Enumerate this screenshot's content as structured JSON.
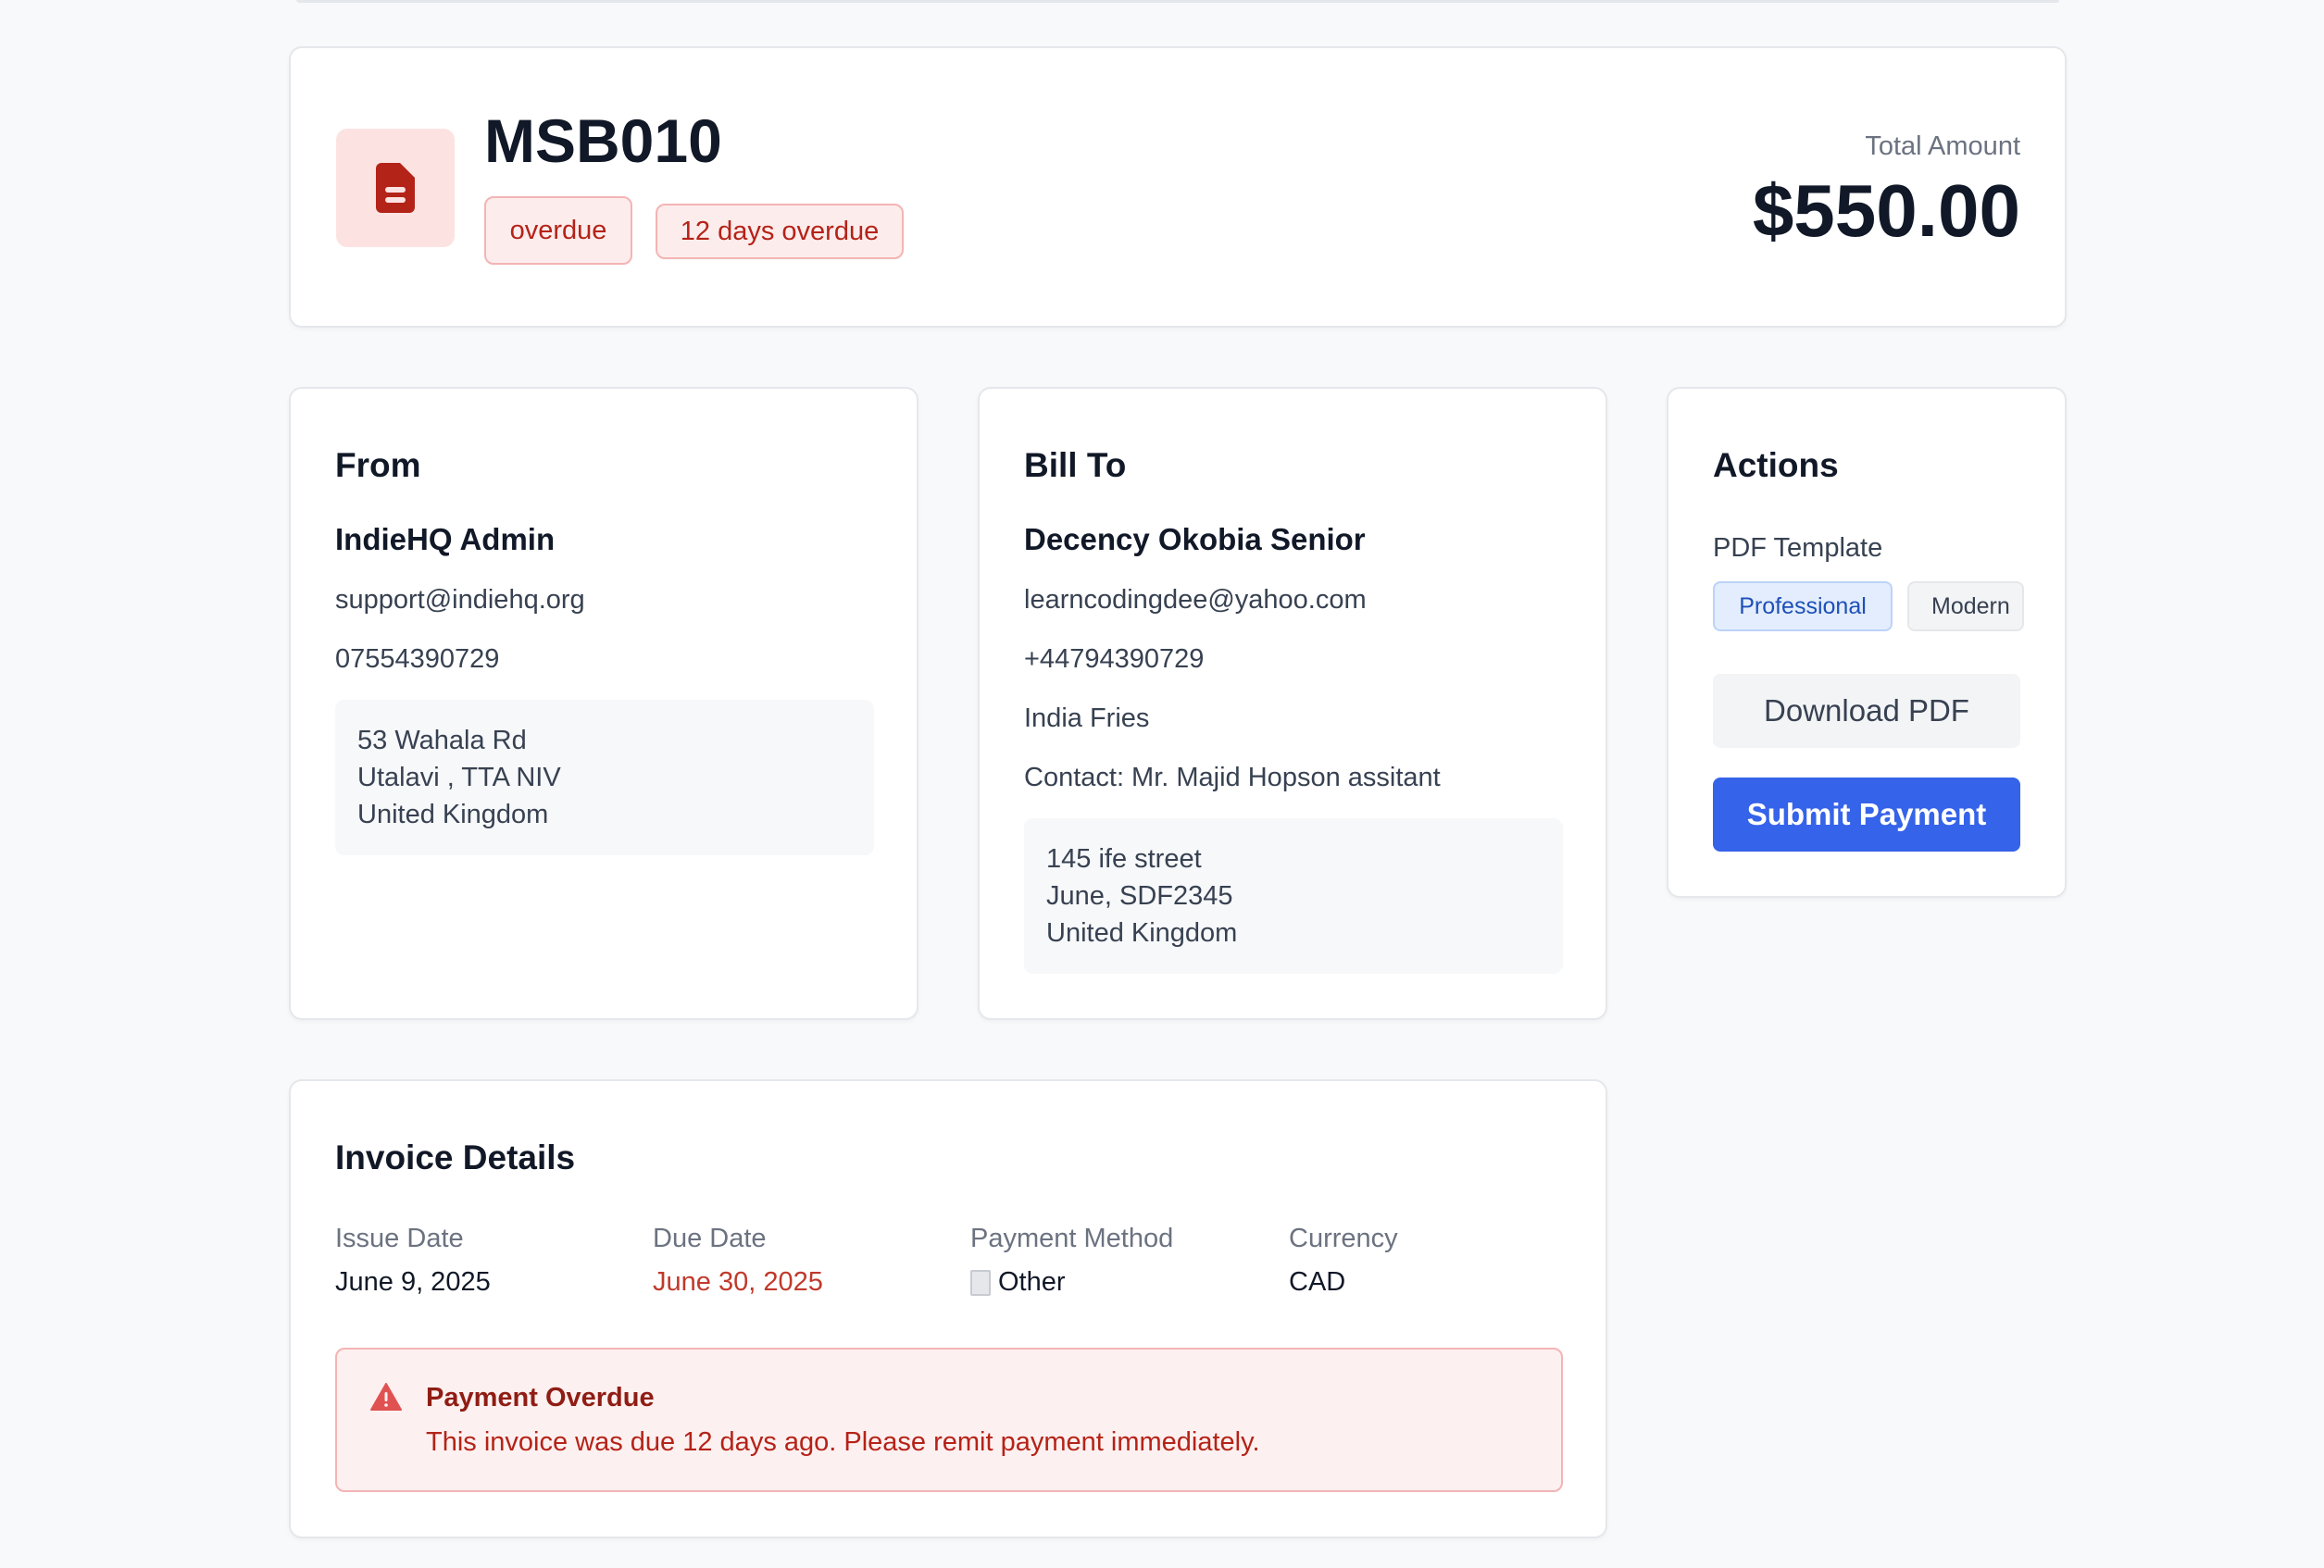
{
  "invoice": {
    "number": "MSB010",
    "status": "overdue",
    "overdue_text": "12 days overdue",
    "total_label": "Total Amount",
    "total_amount": "$550.00"
  },
  "from": {
    "title": "From",
    "name": "IndieHQ Admin",
    "email": "support@indiehq.org",
    "phone": "07554390729",
    "address": [
      "53 Wahala Rd",
      "Utalavi , TTA NIV",
      "United Kingdom"
    ]
  },
  "bill_to": {
    "title": "Bill To",
    "name": "Decency Okobia Senior",
    "email": "learncodingdee@yahoo.com",
    "phone": "+44794390729",
    "company": "India Fries",
    "contact": "Contact: Mr. Majid Hopson assitant",
    "address": [
      "145 ife street",
      "June, SDF2345",
      "United Kingdom"
    ]
  },
  "actions": {
    "title": "Actions",
    "pdf_template_label": "PDF Template",
    "templates": [
      "Professional",
      "Modern"
    ],
    "selected_template": "Professional",
    "download_label": "Download PDF",
    "submit_label": "Submit Payment"
  },
  "details": {
    "title": "Invoice Details",
    "issue_date_label": "Issue Date",
    "issue_date": "June 9, 2025",
    "due_date_label": "Due Date",
    "due_date": "June 30, 2025",
    "payment_method_label": "Payment Method",
    "payment_method": "Other",
    "currency_label": "Currency",
    "currency": "CAD"
  },
  "alert": {
    "title": "Payment Overdue",
    "message": "This invoice was due 12 days ago. Please remit payment immediately."
  },
  "colors": {
    "accent": "#3563e9",
    "danger": "#b42318",
    "danger_bg": "#fdecec"
  }
}
